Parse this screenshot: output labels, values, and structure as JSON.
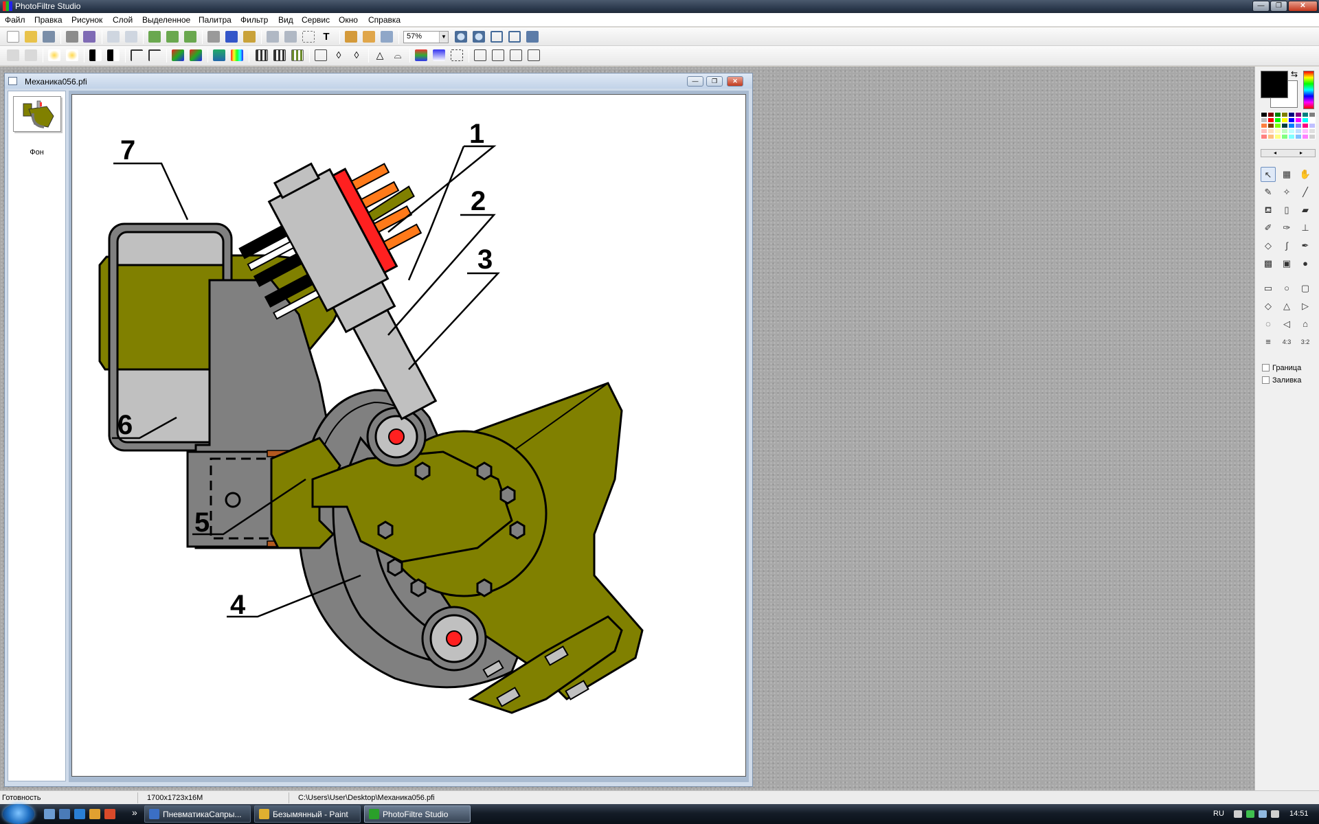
{
  "window": {
    "title": "PhotoFiltre Studio",
    "min_label": "—",
    "max_label": "❐",
    "close_label": "✕"
  },
  "menu": [
    "Файл",
    "Правка",
    "Рисунок",
    "Слой",
    "Выделенное",
    "Палитра",
    "Фильтр",
    "Вид",
    "Сервис",
    "Окно",
    "Справка"
  ],
  "toolbar": {
    "zoom_value": "57%",
    "zoom_dropdown_icon": "chevron-down-icon"
  },
  "document": {
    "title": "Механика056.pfi",
    "min_label": "—",
    "max_label": "❐",
    "close_label": "✕",
    "layer_name": "Фон",
    "callouts": [
      "1",
      "2",
      "3",
      "4",
      "5",
      "6",
      "7"
    ]
  },
  "palette": {
    "swap_icon": "swap-colors-icon",
    "scroll_left": "◂",
    "scroll_right": "▸",
    "tools": [
      {
        "name": "pointer-tool-icon",
        "glyph": "↖"
      },
      {
        "name": "selection-tool-icon",
        "glyph": "▦"
      },
      {
        "name": "hand-tool-icon",
        "glyph": "✋"
      },
      {
        "name": "eyedropper-tool-icon",
        "glyph": "✎"
      },
      {
        "name": "magic-wand-tool-icon",
        "glyph": "✧"
      },
      {
        "name": "line-tool-icon",
        "glyph": "╱"
      },
      {
        "name": "fill-tool-icon",
        "glyph": "⛾"
      },
      {
        "name": "spray-tool-icon",
        "glyph": "▯"
      },
      {
        "name": "eraser-tool-icon",
        "glyph": "▰"
      },
      {
        "name": "brush-tool-icon",
        "glyph": "✐"
      },
      {
        "name": "advanced-brush-tool-icon",
        "glyph": "✑"
      },
      {
        "name": "stamp-tool-icon",
        "glyph": "⊥"
      },
      {
        "name": "blur-tool-icon",
        "glyph": "◇"
      },
      {
        "name": "smudge-tool-icon",
        "glyph": "∫"
      },
      {
        "name": "clone-tool-icon",
        "glyph": "✒"
      },
      {
        "name": "pattern-tool-icon",
        "glyph": "▩"
      },
      {
        "name": "portrait-tool-icon",
        "glyph": "▣"
      },
      {
        "name": "tube-tool-icon",
        "glyph": "●"
      }
    ],
    "shapes": [
      {
        "name": "rectangle-shape-icon",
        "glyph": "▭"
      },
      {
        "name": "ellipse-shape-icon",
        "glyph": "○"
      },
      {
        "name": "rounded-rectangle-shape-icon",
        "glyph": "▢"
      },
      {
        "name": "diamond-shape-icon",
        "glyph": "◇"
      },
      {
        "name": "triangle-shape-icon",
        "glyph": "△"
      },
      {
        "name": "triangle-right-shape-icon",
        "glyph": "▷"
      },
      {
        "name": "lasso-shape-icon",
        "glyph": "◌"
      },
      {
        "name": "polygon-shape-icon",
        "glyph": "◁"
      },
      {
        "name": "open-shape-icon",
        "glyph": "⌂"
      },
      {
        "name": "line-width-icon",
        "glyph": "≡"
      },
      {
        "name": "ratio-4-3-icon",
        "glyph": "4:3"
      },
      {
        "name": "ratio-3-2-icon",
        "glyph": "3:2"
      }
    ],
    "border_label": "Граница",
    "fill_label": "Заливка",
    "swatch_colors": [
      "#000000",
      "#800000",
      "#008000",
      "#808000",
      "#000080",
      "#800080",
      "#008080",
      "#808080",
      "#c0c0c0",
      "#ff0000",
      "#00ff00",
      "#ffff00",
      "#0000ff",
      "#ff00ff",
      "#00ffff",
      "#ffffff",
      "#ff8040",
      "#804000",
      "#80ff00",
      "#004040",
      "#0080ff",
      "#8080ff",
      "#ff0080",
      "#c0c0ff",
      "#ffc0c0",
      "#ffe0c0",
      "#ffffc0",
      "#c0ffc0",
      "#c0ffff",
      "#c0e0ff",
      "#ffc0ff",
      "#e0e0e0",
      "#ff8080",
      "#ffc080",
      "#ffff80",
      "#80ff80",
      "#80ffff",
      "#80c0ff",
      "#ff80ff",
      "#d0d0d0"
    ]
  },
  "status": {
    "state": "Готовность",
    "size": "1700x1723x16M",
    "path": "C:\\Users\\User\\Desktop\\Механика056.pfi"
  },
  "taskbar": {
    "overflow_label": "»",
    "tasks": [
      {
        "label": "ПневматикаСапры...",
        "icon_color": "#3b6fc4",
        "active": false
      },
      {
        "label": "Безымянный - Paint",
        "icon_color": "#e0b030",
        "active": false
      },
      {
        "label": "PhotoFiltre Studio",
        "icon_color": "#2aa02a",
        "active": true
      }
    ],
    "lang": "RU",
    "time": "14:51"
  },
  "colors": {
    "olive": "#808000",
    "gray_part": "#808080",
    "red_part": "#ff2020",
    "orange_part": "#ff7a1a"
  }
}
